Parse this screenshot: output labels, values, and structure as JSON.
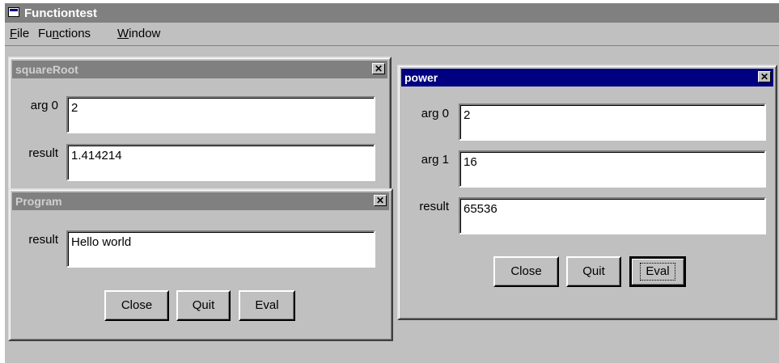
{
  "app": {
    "title": "Functiontest",
    "menu": {
      "file": {
        "u": "F",
        "rest": "ile"
      },
      "functions": {
        "pre": "Fu",
        "u": "n",
        "rest": "ctions"
      },
      "window": {
        "u": "W",
        "rest": "indow"
      }
    }
  },
  "square_root": {
    "title": "squareRoot",
    "close_glyph": "✕",
    "arg0_label": "arg 0",
    "arg0_value": "2",
    "result_label": "result",
    "result_value": "1.414214"
  },
  "program": {
    "title": "Program",
    "close_glyph": "✕",
    "result_label": "result",
    "result_value": "Hello world",
    "close_label": "Close",
    "quit_label": "Quit",
    "eval_label": "Eval"
  },
  "power": {
    "title": "power",
    "close_glyph": "✕",
    "arg0_label": "arg 0",
    "arg0_value": "2",
    "arg1_label": "arg 1",
    "arg1_value": "16",
    "result_label": "result",
    "result_value": "65536",
    "close_label": "Close",
    "quit_label": "Quit",
    "eval_label": "Eval"
  },
  "colors": {
    "active_title": "#000080",
    "inactive_title": "#808080",
    "face": "#c0c0c0"
  }
}
